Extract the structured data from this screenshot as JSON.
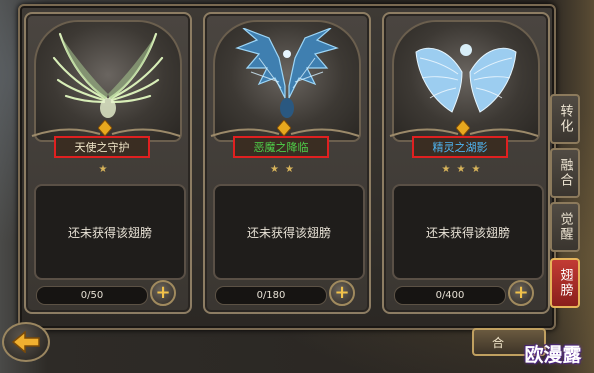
{
  "wings": [
    {
      "name": "天使之守护",
      "name_color": "#f0e6c8",
      "stars": "★",
      "status": "还未获得该翅膀",
      "progress_text": "0/50",
      "progress_current": 0,
      "progress_max": 50,
      "wing_color": "#cfe6b0",
      "wing_icon": "angel-wing-icon"
    },
    {
      "name": "恶魔之降临",
      "name_color": "#4fd34a",
      "stars": "★★",
      "status": "还未获得该翅膀",
      "progress_text": "0/180",
      "progress_current": 0,
      "progress_max": 180,
      "wing_color": "#5fa8d8",
      "wing_icon": "demon-wing-icon"
    },
    {
      "name": "精灵之湖影",
      "name_color": "#4fb4f0",
      "stars": "★★★",
      "status": "还未获得该翅膀",
      "progress_text": "0/400",
      "progress_current": 0,
      "progress_max": 400,
      "wing_color": "#a8d8f8",
      "wing_icon": "elf-wing-icon"
    }
  ],
  "side_tabs": [
    {
      "label": "转化",
      "active": false
    },
    {
      "label": "融合",
      "active": false
    },
    {
      "label": "觉醒",
      "active": false
    },
    {
      "label": "翅膀",
      "active": true
    }
  ],
  "bottom_button_label": "合",
  "watermark": "欧漫露",
  "plus_glyph": "+",
  "colors": {
    "frame": "#7a6a52",
    "highlight_box": "#e02020",
    "active_tab": "#c23b34",
    "star": "#d8b45a"
  }
}
